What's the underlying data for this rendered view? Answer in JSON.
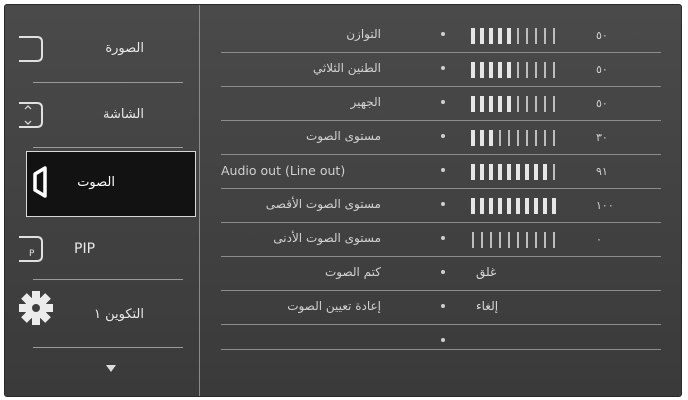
{
  "sidebar": {
    "items": [
      {
        "label": "الصورة",
        "icon": "picture-icon"
      },
      {
        "label": "الشاشة",
        "icon": "screen-icon"
      },
      {
        "label": "الصوت",
        "icon": "sound-icon"
      },
      {
        "label": "PIP",
        "icon": "pip-icon",
        "icon_text": "P"
      },
      {
        "label": "التكوين ١",
        "icon": "gear-icon"
      }
    ],
    "more": "chevron-down-icon"
  },
  "settings": [
    {
      "label": "التوازن",
      "value": "٥٠",
      "level": 0.5
    },
    {
      "label": "الطنين الثلاثي",
      "value": "٥٠",
      "level": 0.5
    },
    {
      "label": "الجهير",
      "value": "٥٠",
      "level": 0.5
    },
    {
      "label": "مستوى الصوت",
      "value": "٣٠",
      "level": 0.3
    },
    {
      "label": "Audio out (Line out)",
      "value": "٩١",
      "level": 0.91
    },
    {
      "label": "مستوى الصوت الأقصى",
      "value": "١٠٠",
      "level": 1.0
    },
    {
      "label": "مستوى الصوت الأدنى",
      "value": "٠",
      "level": 0.0
    },
    {
      "label": "كتم الصوت",
      "option": "غلق"
    },
    {
      "label": "إعادة تعيين الصوت",
      "option": "إلغاء"
    },
    {
      "label": ""
    }
  ],
  "colors": {
    "background": "#3f3f3f",
    "active": "#121212",
    "text": "#dcdcdc"
  }
}
